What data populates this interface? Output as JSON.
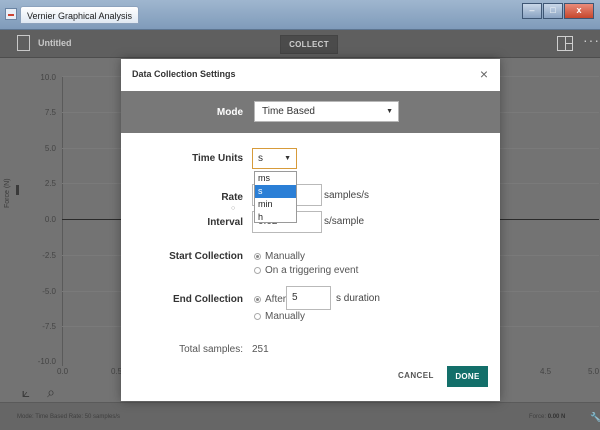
{
  "window": {
    "title": "Vernier Graphical Analysis",
    "buttons": {
      "minimize": "–",
      "maximize": "□",
      "close": "x"
    }
  },
  "toolbar": {
    "doc_title": "Untitled",
    "collect_label": "COLLECT",
    "more_label": "···"
  },
  "graph": {
    "y_ticks": [
      "10.0",
      "7.5",
      "5.0",
      "2.5",
      "0.0",
      "-2.5",
      "-5.0",
      "-7.5",
      "-10.0"
    ],
    "x_ticks": [
      "0.0",
      "0.5",
      "4.5",
      "5.0"
    ],
    "y_axis_label": "Force (N)"
  },
  "status": {
    "left": "Mode: Time Based  Rate: 50 samples/s",
    "right_label": "Force:",
    "right_value": "0.00 N"
  },
  "modal": {
    "title": "Data Collection Settings",
    "close_label": "×",
    "mode": {
      "label": "Mode",
      "value": "Time Based"
    },
    "time_units": {
      "label": "Time Units",
      "value": "s",
      "options": [
        "ms",
        "s",
        "min",
        "h"
      ]
    },
    "rate": {
      "label": "Rate",
      "unit": "samples/s"
    },
    "interval": {
      "label": "Interval",
      "value": "0.02",
      "unit": "s/sample"
    },
    "start_collection": {
      "label": "Start Collection",
      "option_manual": "Manually",
      "option_trigger": "On a triggering event"
    },
    "end_collection": {
      "label": "End Collection",
      "option_after": "After",
      "after_value": "5",
      "after_unit": "s duration",
      "option_manual": "Manually"
    },
    "total_samples": {
      "label": "Total samples:",
      "value": "251"
    },
    "cancel_label": "CANCEL",
    "done_label": "DONE"
  }
}
